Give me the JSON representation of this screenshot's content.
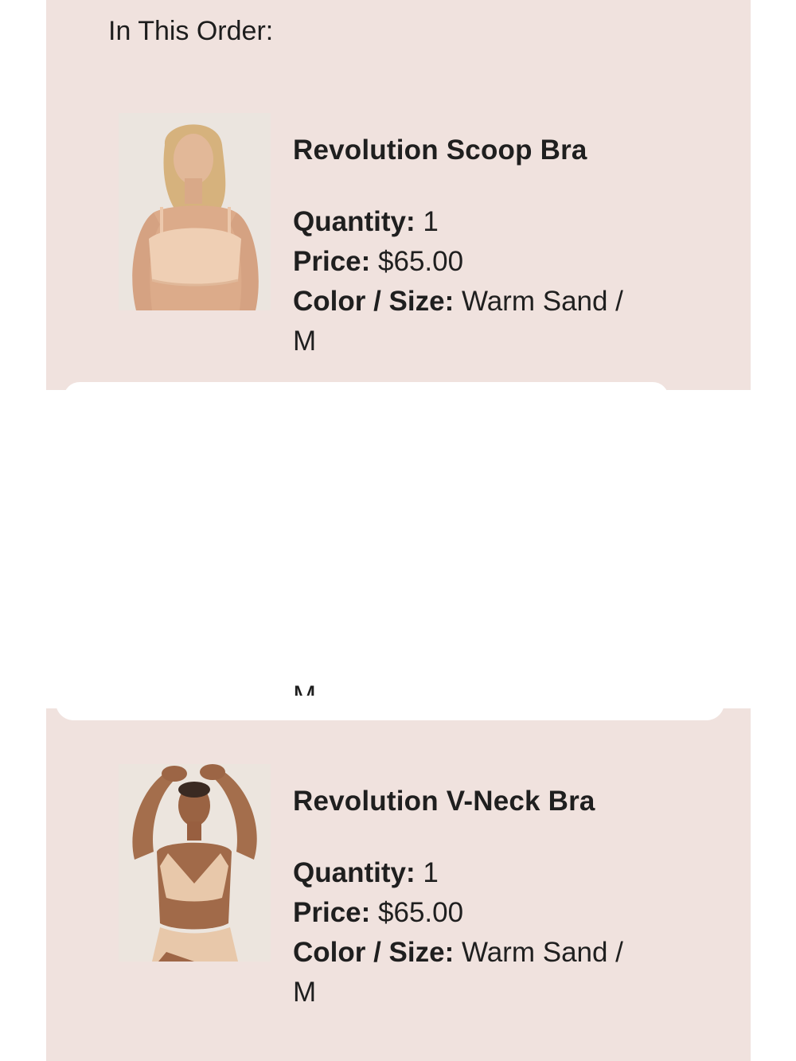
{
  "order": {
    "heading": "In This Order:",
    "items": [
      {
        "name": "Revolution Scoop Bra",
        "quantity_label": "Quantity:",
        "quantity": "1",
        "price_label": "Price:",
        "price": "$65.00",
        "color_size_label": "Color / Size:",
        "color_size_line1": "Warm Sand /",
        "color_size_line2": "M"
      },
      {
        "name": "Revolution V-Neck Bra",
        "quantity_label": "Quantity:",
        "quantity": "1",
        "price_label": "Price:",
        "price": "$65.00",
        "color_size_label": "Color / Size:",
        "color_size_line1": "Warm Sand /",
        "color_size_line2": "M"
      }
    ],
    "partially_visible_text": "M"
  },
  "colors": {
    "panel_background": "#f0e2de",
    "text": "#1f1f1f",
    "redaction": "#ffffff"
  }
}
